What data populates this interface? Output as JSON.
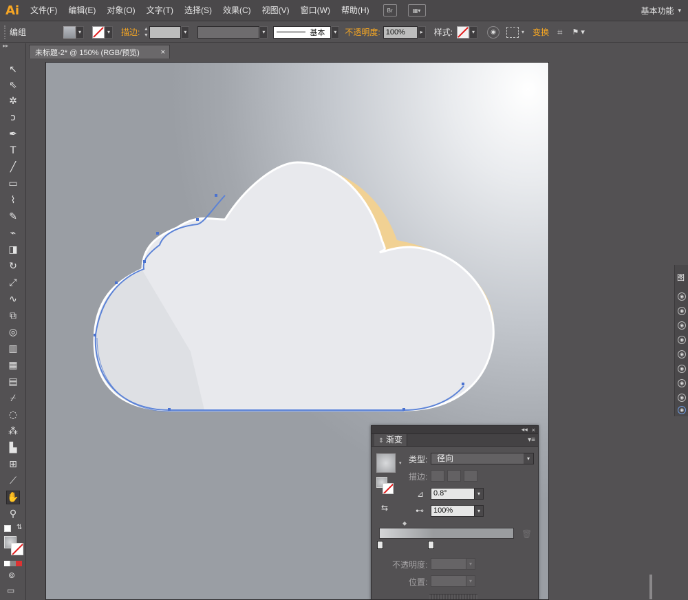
{
  "app": {
    "logo": "Ai",
    "menu": [
      "文件(F)",
      "编辑(E)",
      "对象(O)",
      "文字(T)",
      "选择(S)",
      "效果(C)",
      "视图(V)",
      "窗口(W)",
      "帮助(H)"
    ],
    "bridge_label": "Br",
    "workspace": "基本功能",
    "accent_color": "#f7a624"
  },
  "control": {
    "selection": "编组",
    "stroke_label": "描边:",
    "stroke_style": "基本",
    "opacity_label": "不透明度:",
    "opacity_value": "100%",
    "style_label": "样式:",
    "transform_label": "变换"
  },
  "document": {
    "tab_title": "未标题-2* @ 150% (RGB/预览)",
    "close_glyph": "×"
  },
  "tools": [
    {
      "name": "selection-tool-icon",
      "glyph": "↖"
    },
    {
      "name": "direct-selection-tool-icon",
      "glyph": "⇖"
    },
    {
      "name": "magic-wand-tool-icon",
      "glyph": "✲"
    },
    {
      "name": "lasso-tool-icon",
      "glyph": "ↄ"
    },
    {
      "name": "pen-tool-icon",
      "glyph": "✒"
    },
    {
      "name": "type-tool-icon",
      "glyph": "T"
    },
    {
      "name": "line-tool-icon",
      "glyph": "╱"
    },
    {
      "name": "rectangle-tool-icon",
      "glyph": "▭"
    },
    {
      "name": "paintbrush-tool-icon",
      "glyph": "⌇"
    },
    {
      "name": "pencil-tool-icon",
      "glyph": "✎"
    },
    {
      "name": "blob-brush-tool-icon",
      "glyph": "⌁"
    },
    {
      "name": "eraser-tool-icon",
      "glyph": "◨"
    },
    {
      "name": "rotate-tool-icon",
      "glyph": "↻"
    },
    {
      "name": "scale-tool-icon",
      "glyph": "⤢"
    },
    {
      "name": "warp-tool-icon",
      "glyph": "∿"
    },
    {
      "name": "free-transform-tool-icon",
      "glyph": "⧉"
    },
    {
      "name": "shape-builder-tool-icon",
      "glyph": "◎"
    },
    {
      "name": "perspective-grid-tool-icon",
      "glyph": "▥"
    },
    {
      "name": "mesh-tool-icon",
      "glyph": "▦"
    },
    {
      "name": "gradient-tool-icon",
      "glyph": "▤"
    },
    {
      "name": "eyedropper-tool-icon",
      "glyph": "⌿"
    },
    {
      "name": "blend-tool-icon",
      "glyph": "◌"
    },
    {
      "name": "symbol-sprayer-tool-icon",
      "glyph": "⁂"
    },
    {
      "name": "column-graph-tool-icon",
      "glyph": "▙"
    },
    {
      "name": "artboard-tool-icon",
      "glyph": "⊞"
    },
    {
      "name": "slice-tool-icon",
      "glyph": "⟋"
    },
    {
      "name": "hand-tool-icon",
      "glyph": "✋"
    },
    {
      "name": "zoom-tool-icon",
      "glyph": "⚲"
    }
  ],
  "gradient_panel": {
    "title": "渐变",
    "type_label": "类型:",
    "type_value": "径向",
    "stroke_label": "描边:",
    "angle_value": "0.8°",
    "aspect_value": "100%",
    "opacity_label": "不透明度:",
    "location_label": "位置:",
    "collapse_glyph": "◂◂",
    "close_glyph": "×",
    "menu_glyph": "▾≡"
  },
  "right_dock": {
    "title": "图"
  }
}
